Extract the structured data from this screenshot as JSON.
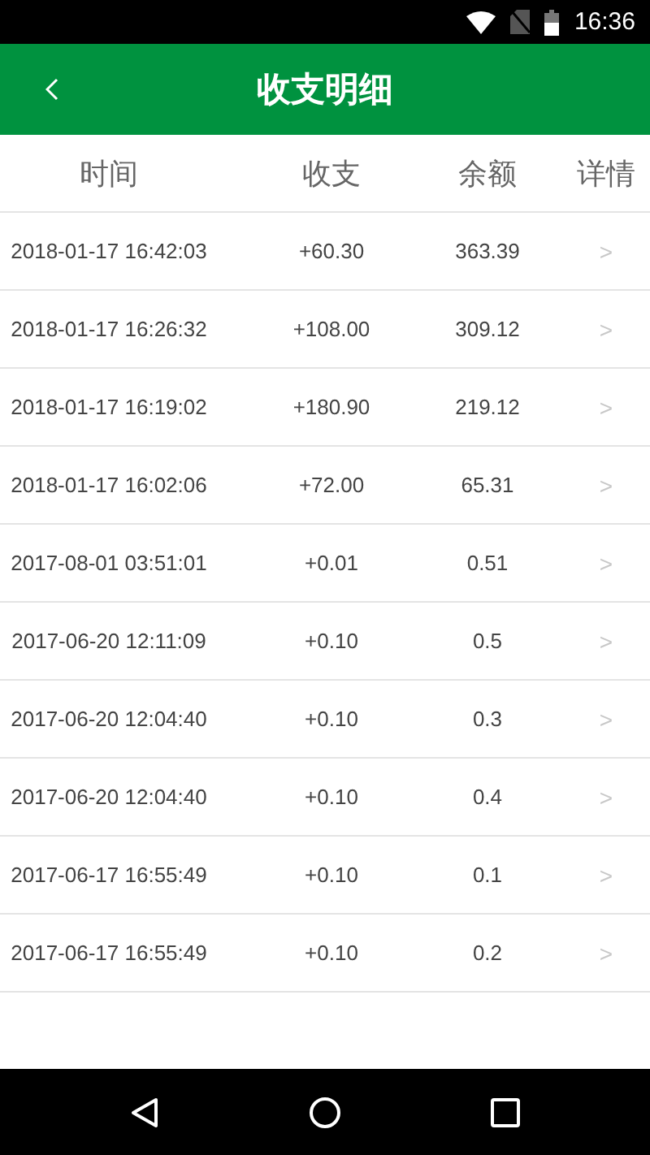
{
  "status_bar": {
    "time": "16:36"
  },
  "header": {
    "title": "收支明细"
  },
  "table": {
    "columns": [
      "时间",
      "收支",
      "余额",
      "详情"
    ],
    "rows": [
      {
        "time": "2018-01-17 16:42:03",
        "amount": "+60.30",
        "balance": "363.39",
        "detail": ">"
      },
      {
        "time": "2018-01-17 16:26:32",
        "amount": "+108.00",
        "balance": "309.12",
        "detail": ">"
      },
      {
        "time": "2018-01-17 16:19:02",
        "amount": "+180.90",
        "balance": "219.12",
        "detail": ">"
      },
      {
        "time": "2018-01-17 16:02:06",
        "amount": "+72.00",
        "balance": "65.31",
        "detail": ">"
      },
      {
        "time": "2017-08-01 03:51:01",
        "amount": "+0.01",
        "balance": "0.51",
        "detail": ">"
      },
      {
        "time": "2017-06-20 12:11:09",
        "amount": "+0.10",
        "balance": "0.5",
        "detail": ">"
      },
      {
        "time": "2017-06-20 12:04:40",
        "amount": "+0.10",
        "balance": "0.3",
        "detail": ">"
      },
      {
        "time": "2017-06-20 12:04:40",
        "amount": "+0.10",
        "balance": "0.4",
        "detail": ">"
      },
      {
        "time": "2017-06-17 16:55:49",
        "amount": "+0.10",
        "balance": "0.1",
        "detail": ">"
      },
      {
        "time": "2017-06-17 16:55:49",
        "amount": "+0.10",
        "balance": "0.2",
        "detail": ">"
      }
    ]
  }
}
